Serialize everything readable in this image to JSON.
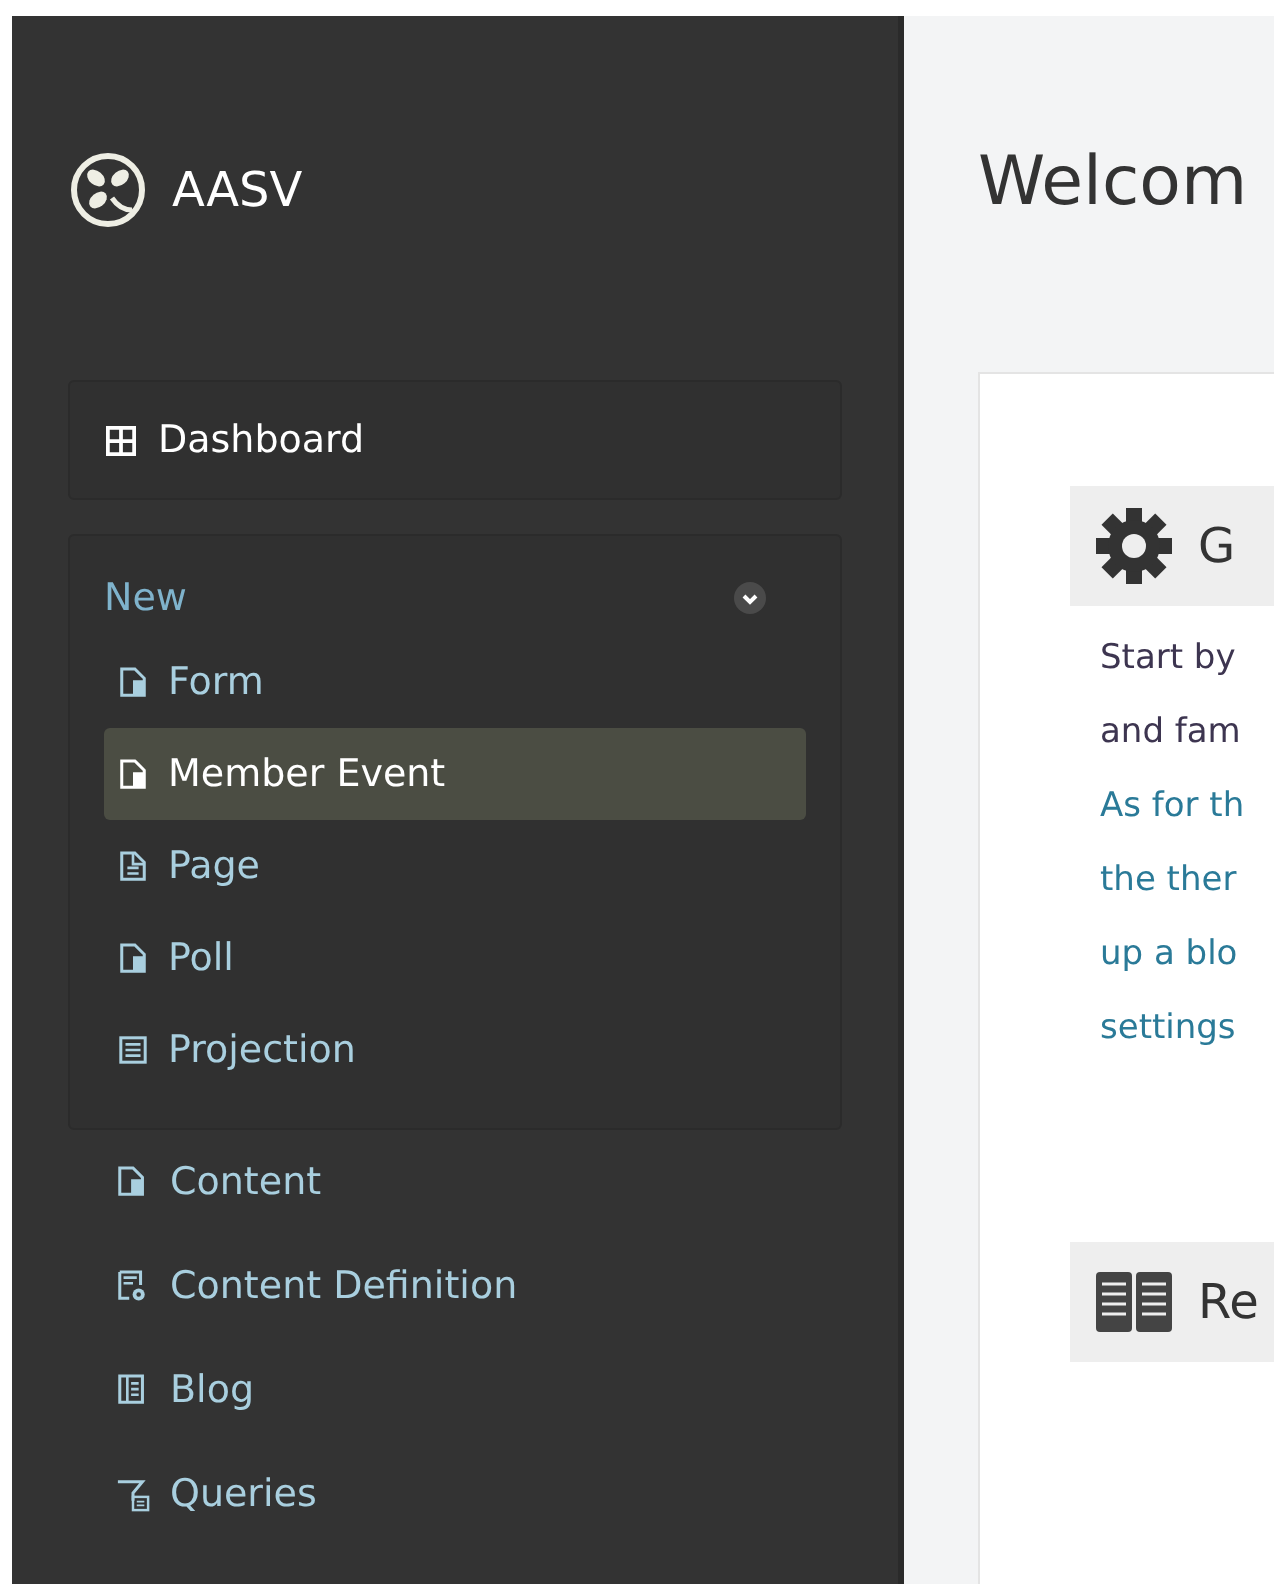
{
  "brand": {
    "name": "AASV"
  },
  "nav": {
    "dashboard": {
      "label": "Dashboard"
    },
    "group": {
      "label": "New",
      "expanded": true,
      "items": [
        {
          "label": "Form",
          "kind": "file",
          "selected": false
        },
        {
          "label": "Member Event",
          "kind": "file",
          "selected": true
        },
        {
          "label": "Page",
          "kind": "file-lines",
          "selected": false
        },
        {
          "label": "Poll",
          "kind": "file",
          "selected": false
        },
        {
          "label": "Projection",
          "kind": "list",
          "selected": false
        }
      ]
    },
    "items": [
      {
        "label": "Content",
        "kind": "file"
      },
      {
        "label": "Content Definition",
        "kind": "gear-file"
      },
      {
        "label": "Blog",
        "kind": "blog"
      },
      {
        "label": "Queries",
        "kind": "filter"
      }
    ]
  },
  "main": {
    "title": "Welcom",
    "panels": [
      {
        "heading": "G",
        "kind": "gear",
        "lines": [
          {
            "text": "Start by",
            "kind": "text"
          },
          {
            "text": "and fam",
            "kind": "text"
          },
          {
            "text": "As for th",
            "kind": "link"
          },
          {
            "text": "the ther",
            "kind": "link"
          },
          {
            "text": "up a blo",
            "kind": "link"
          },
          {
            "text": "settings",
            "kind": "link"
          }
        ]
      },
      {
        "heading": "Re",
        "kind": "book"
      }
    ]
  }
}
